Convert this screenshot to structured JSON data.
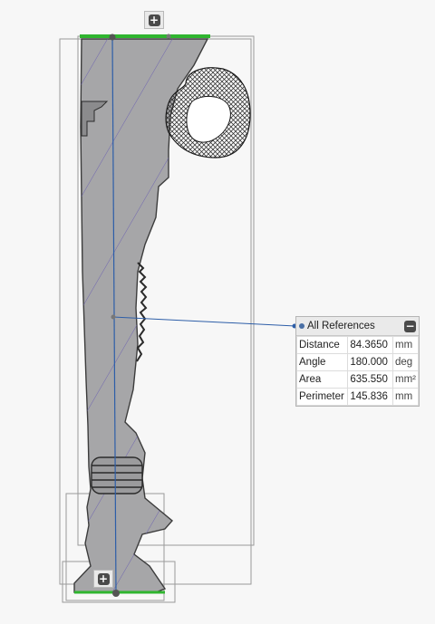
{
  "buttons": {
    "top_expand_label": "+",
    "bottom_expand_label": "+"
  },
  "reference_panel": {
    "title": "All References",
    "collapse_label": "−",
    "rows": [
      {
        "label": "Distance",
        "value": "84.3650",
        "unit": "mm"
      },
      {
        "label": "Angle",
        "value": "180.000",
        "unit": "deg"
      },
      {
        "label": "Area",
        "value": "635.550",
        "unit": "mm²"
      },
      {
        "label": "Perimeter",
        "value": "145.836",
        "unit": "mm"
      }
    ]
  },
  "colors": {
    "section_fill": "#a6a6a8",
    "hatch": "#6a5fb0",
    "outline": "#3c3c3c",
    "axis_line": "#2d5ea8",
    "edge_highlight": "#2fb52f",
    "frame": "#9a9a9a"
  }
}
